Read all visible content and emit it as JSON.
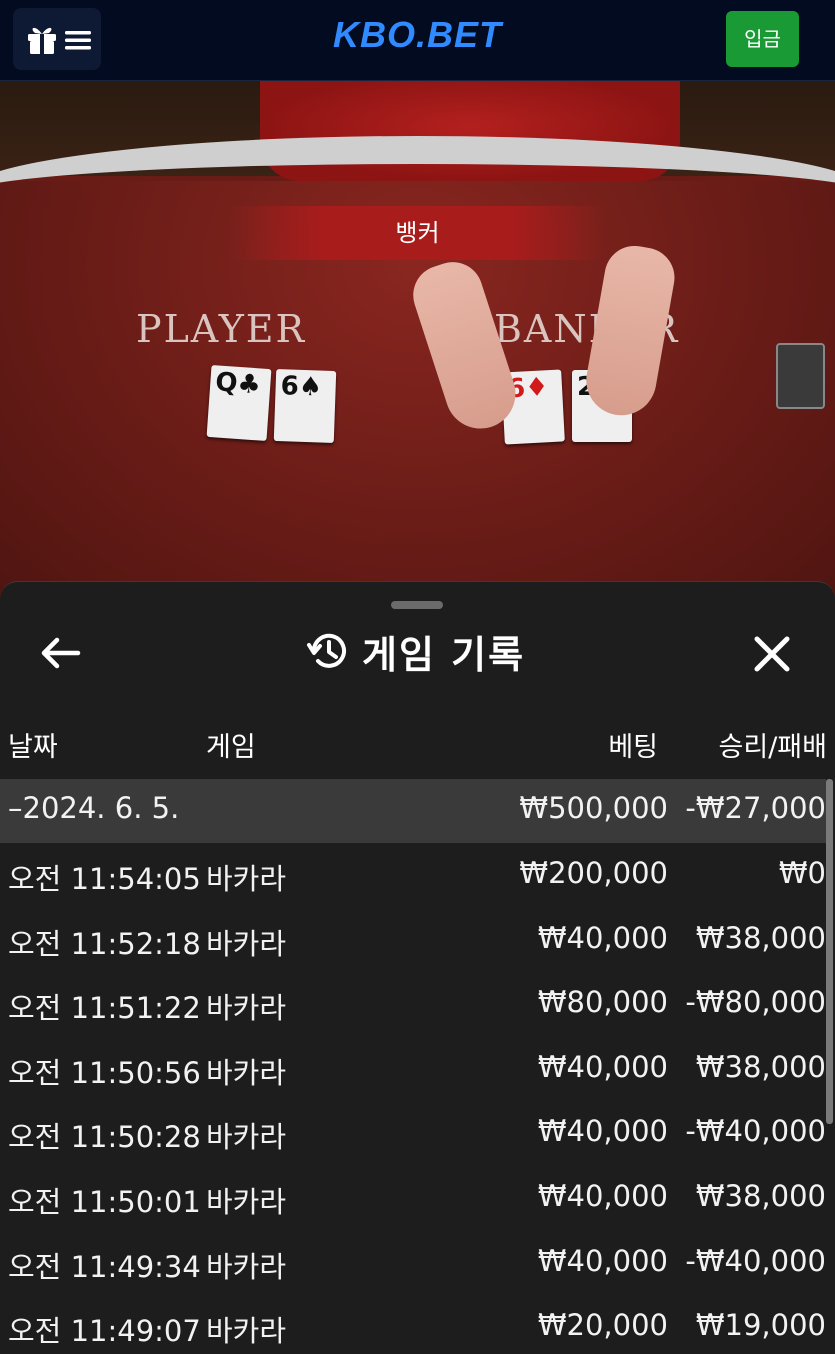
{
  "header": {
    "logo": "KBO.BET",
    "deposit_label": "입금"
  },
  "table": {
    "result_banner": "뱅커",
    "player_label": "PLAYER",
    "banker_label": "BANKER",
    "player_cards": [
      {
        "rank": "Q",
        "suit": "♣",
        "color": "#111111"
      },
      {
        "rank": "6",
        "suit": "♠",
        "color": "#111111"
      }
    ],
    "banker_cards": [
      {
        "rank": "6",
        "suit": "♦",
        "color": "#d11919"
      },
      {
        "rank": "2",
        "suit": "♠",
        "color": "#111111"
      }
    ]
  },
  "history": {
    "title": "게임 기록",
    "columns": {
      "date": "날짜",
      "game": "게임",
      "bet": "베팅",
      "result": "승리/패배"
    },
    "summary": {
      "date": "–2024. 6. 5.",
      "game": "",
      "bet": "₩500,000",
      "result": "-₩27,000"
    },
    "rows": [
      {
        "time": "오전 11:54:05",
        "game": "바카라",
        "bet": "₩200,000",
        "result": "₩0"
      },
      {
        "time": "오전 11:52:18",
        "game": "바카라",
        "bet": "₩40,000",
        "result": "₩38,000"
      },
      {
        "time": "오전 11:51:22",
        "game": "바카라",
        "bet": "₩80,000",
        "result": "-₩80,000"
      },
      {
        "time": "오전 11:50:56",
        "game": "바카라",
        "bet": "₩40,000",
        "result": "₩38,000"
      },
      {
        "time": "오전 11:50:28",
        "game": "바카라",
        "bet": "₩40,000",
        "result": "-₩40,000"
      },
      {
        "time": "오전 11:50:01",
        "game": "바카라",
        "bet": "₩40,000",
        "result": "₩38,000"
      },
      {
        "time": "오전 11:49:34",
        "game": "바카라",
        "bet": "₩40,000",
        "result": "-₩40,000"
      },
      {
        "time": "오전 11:49:07",
        "game": "바카라",
        "bet": "₩20,000",
        "result": "₩19,000"
      }
    ]
  },
  "colors": {
    "accent_logo": "#2f8bff",
    "deposit_green": "#1a9a34",
    "header_bg": "#020b1f",
    "sheet_bg": "#1d1d1d",
    "felt_red": "#6e1d17"
  }
}
